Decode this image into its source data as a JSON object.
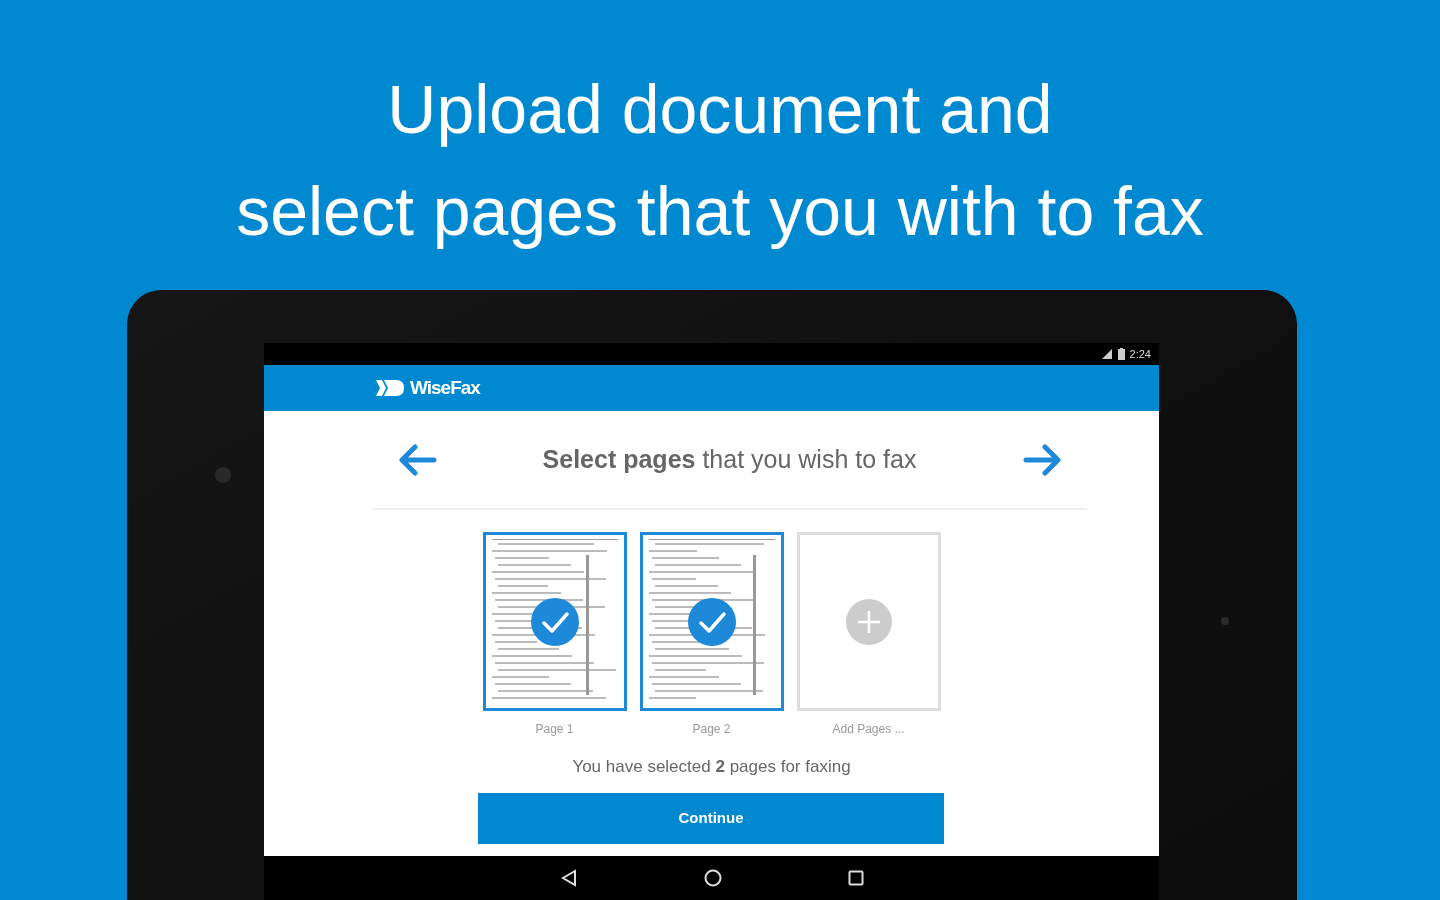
{
  "headline": [
    "Upload document and",
    "select pages that you with to fax"
  ],
  "status_bar": {
    "time": "2:24"
  },
  "app_bar": {
    "title": "WiseFax"
  },
  "header": {
    "title": "**Select pages** that you wish to fax"
  },
  "pages": [
    {
      "kind": "page",
      "label": "Page 1",
      "selected": true
    },
    {
      "kind": "page",
      "label": "Page 2",
      "selected": true
    },
    {
      "kind": "add",
      "label": "Add Pages ..."
    }
  ],
  "summary": "You have selected **2** pages for faxing",
  "button": "Continue"
}
